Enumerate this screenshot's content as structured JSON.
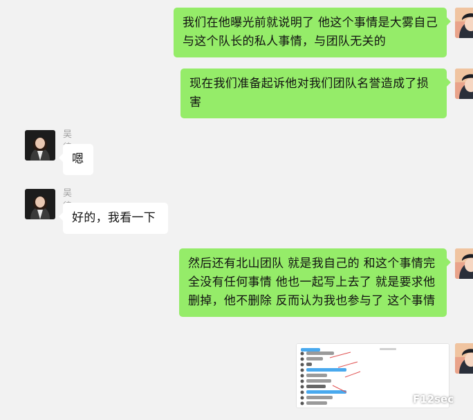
{
  "colors": {
    "background": "#f2f2f2",
    "self_bubble": "#95ec69",
    "other_bubble": "#ffffff",
    "sender_name": "#a0a0a0"
  },
  "messages": [
    {
      "from": "self",
      "text": "我们在他曝光前就说明了  他这个事情是大雾自己与这个队长的私人事情，与团队无关的"
    },
    {
      "from": "self",
      "text": "现在我们准备起诉他对我们团队名誉造成了损害"
    },
    {
      "from": "other",
      "sender": "吴律师",
      "text": "嗯"
    },
    {
      "from": "other",
      "sender": "吴律师",
      "text": "好的，我看一下"
    },
    {
      "from": "self",
      "text": "然后还有北山团队 就是我自己的  和这个事情完全没有任何事情  他也一起写上去了  就是要求他删掉，他不删除  反而认为我也参与了 这个事情"
    },
    {
      "from": "self",
      "type": "image",
      "icon": "chat-screenshot-image"
    }
  ],
  "watermark": {
    "text": "F12sec",
    "icon": "wechat-logo-icon"
  }
}
